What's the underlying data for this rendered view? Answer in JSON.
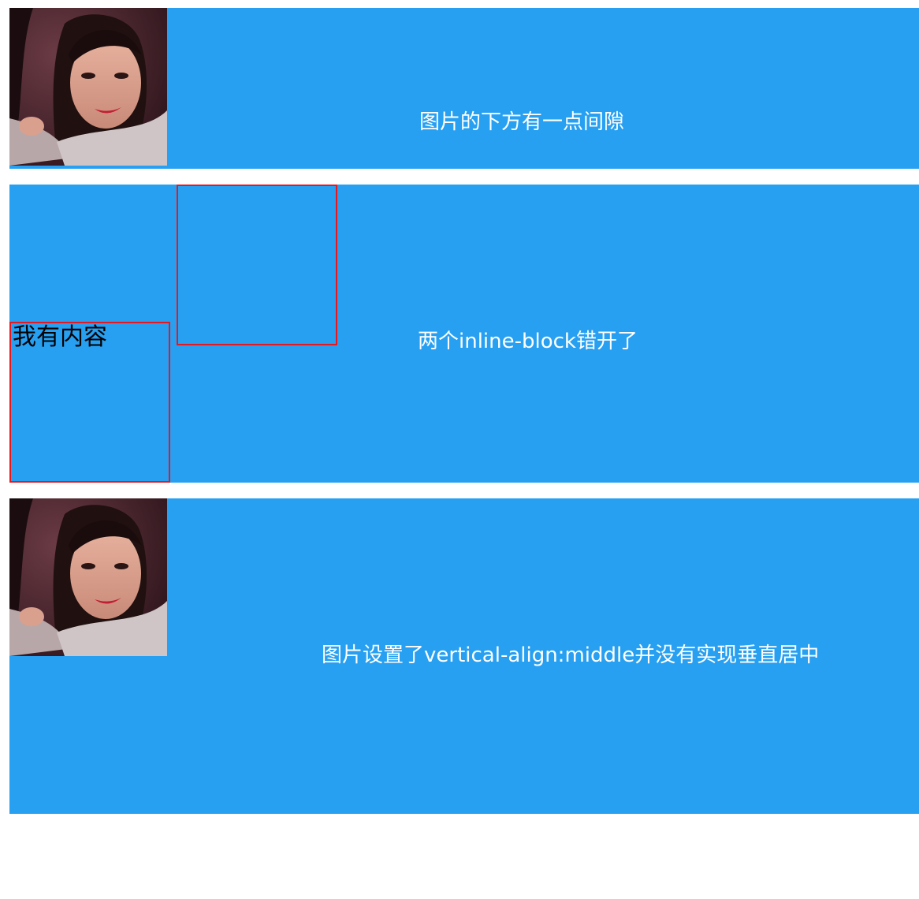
{
  "section1": {
    "caption": "图片的下方有一点间隙",
    "image_alt": "portrait photo"
  },
  "section2": {
    "box1_text": "我有内容",
    "caption": "两个inline-block错开了"
  },
  "section3": {
    "caption": "图片设置了vertical-align:middle并没有实现垂直居中",
    "image_alt": "portrait photo"
  },
  "colors": {
    "band_background": "#27a0f2",
    "box_border": "#e8161d",
    "caption_text": "#ffffff"
  }
}
